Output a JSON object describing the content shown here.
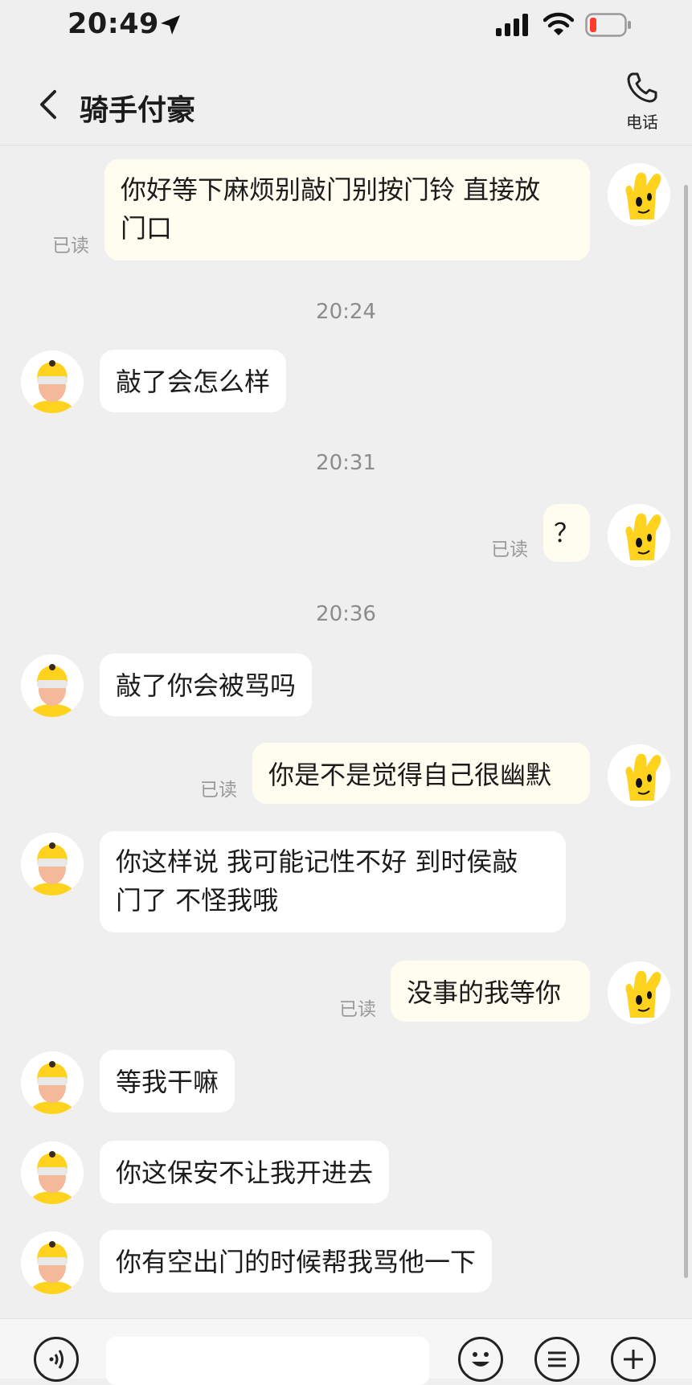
{
  "status_bar": {
    "time": "20:49"
  },
  "header": {
    "title": "骑手付豪",
    "call_label": "电话"
  },
  "read_label": "已读",
  "timestamps": [
    "20:24",
    "20:31",
    "20:36"
  ],
  "messages": [
    {
      "from": "me",
      "lines": [
        "你好等下麻烦别敲门别按门铃 直接放",
        "门口"
      ],
      "read": "已读"
    },
    {
      "from": "rider",
      "text": "敲了会怎么样"
    },
    {
      "from": "me",
      "text": "？",
      "read": "已读"
    },
    {
      "from": "rider",
      "text": "敲了你会被骂吗"
    },
    {
      "from": "me",
      "text": "你是不是觉得自己很幽默",
      "read": "已读"
    },
    {
      "from": "rider",
      "lines": [
        "你这样说 我可能记性不好 到时侯敲",
        "门了 不怪我哦"
      ]
    },
    {
      "from": "me",
      "text": "没事的我等你",
      "read": "已读"
    },
    {
      "from": "rider",
      "text": "等我干嘛"
    },
    {
      "from": "rider",
      "text": "你这保安不让我开进去"
    },
    {
      "from": "rider",
      "text": "你有空出门的时候帮我骂他一下"
    }
  ],
  "colors": {
    "bubble_out": "#fffdf0",
    "bubble_in": "#ffffff",
    "accent_yellow": "#ffd21e",
    "background": "#efefef"
  },
  "icons": [
    "location-arrow-icon",
    "signal-icon",
    "wifi-icon",
    "battery-low-icon",
    "back-chevron-icon",
    "phone-icon",
    "voice-icon",
    "emoji-icon",
    "menu-icon",
    "plus-icon"
  ]
}
